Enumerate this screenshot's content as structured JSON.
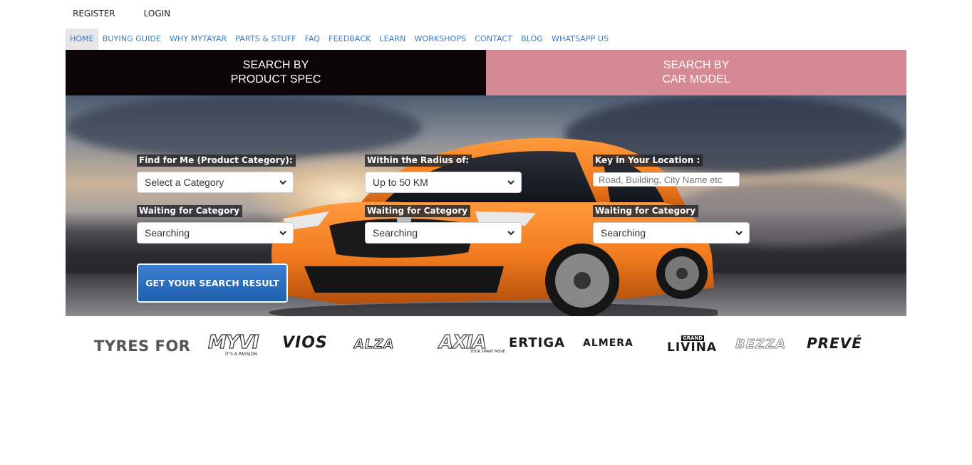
{
  "topbar": {
    "register": "REGISTER",
    "login": "LOGIN"
  },
  "nav": [
    {
      "label": "HOME",
      "active": true
    },
    {
      "label": "BUYING GUIDE"
    },
    {
      "label": "WHY MYTAYAR"
    },
    {
      "label": "PARTS & STUFF"
    },
    {
      "label": "FAQ"
    },
    {
      "label": "FEEDBACK"
    },
    {
      "label": "LEARN"
    },
    {
      "label": "WORKSHOPS"
    },
    {
      "label": "CONTACT"
    },
    {
      "label": "BLOG"
    },
    {
      "label": "WHATSAPP US"
    }
  ],
  "tabs": {
    "spec": "SEARCH BY\nPRODUCT SPEC",
    "car": "SEARCH BY\nCAR MODEL"
  },
  "form": {
    "category_label": "Find for Me (Product Category):",
    "category_value": "Select a Category",
    "radius_label": "Within the Radius of:",
    "radius_value": "Up to 50 KM",
    "location_label": "Key in Your Location :",
    "location_placeholder": "Road, Building, City Name etc",
    "waiting_label": "Waiting for Category",
    "searching_value": "Searching",
    "submit_label": "GET YOUR SEARCH RESULT"
  },
  "brands": {
    "heading": "TYRES FOR",
    "logos": [
      "MYVI",
      "IT'S A PASSION",
      "VIOS",
      "ALZA",
      "AXIA",
      "YOUR SMART MOVE",
      "ERTIGA",
      "ALMERA",
      "GRAND",
      "LIVINA",
      "BEZZA",
      "PREVÉ"
    ]
  },
  "colors": {
    "nav_link": "#3a79c2",
    "tab_spec_bg": "#0d0507",
    "tab_car_bg": "#d58a93",
    "button_bg": "#2a6dbf",
    "car_orange": "#f07a1e"
  }
}
